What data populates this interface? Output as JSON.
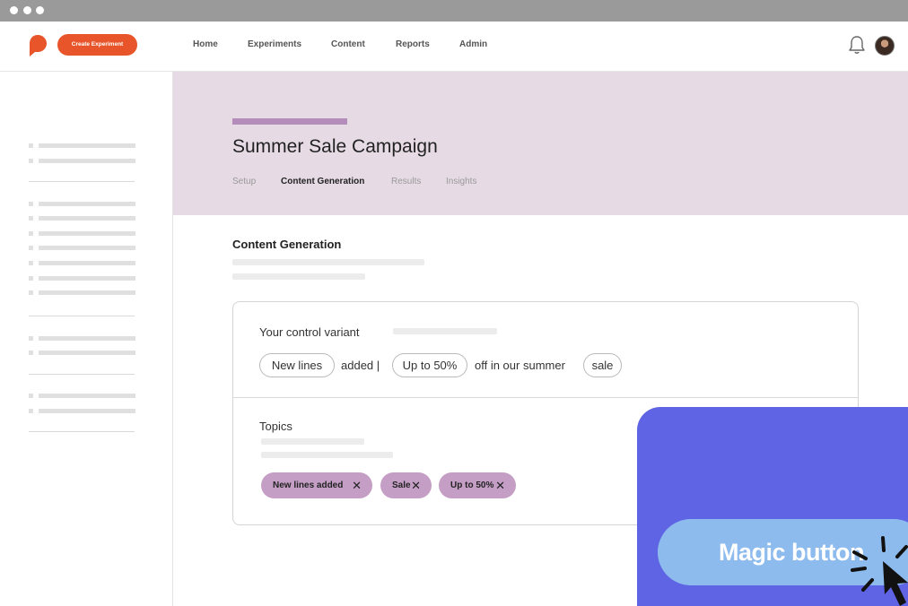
{
  "header": {
    "create_button": "Create Experiment",
    "nav": [
      "Home",
      "Experiments",
      "Content",
      "Reports",
      "Admin"
    ]
  },
  "page": {
    "title": "Summer Sale Campaign",
    "tabs": [
      "Setup",
      "Content Generation",
      "Results",
      "Insights"
    ],
    "active_tab": "Content Generation"
  },
  "content": {
    "section_title": "Content Generation",
    "control_label": "Your control variant",
    "variant": {
      "chip1": "New lines",
      "text1": "added |",
      "chip2": "Up to 50%",
      "text2": "off in our summer",
      "chip3": "sale"
    },
    "topics_label": "Topics",
    "tags": [
      "New lines added",
      "Sale",
      "Up to 50%"
    ],
    "tag_remove_glyph": "✕"
  },
  "overlay": {
    "magic_button": "Magic button"
  },
  "colors": {
    "brand_orange": "#e8552a",
    "header_band": "#e6dbe5",
    "accent_purple": "#b48dba",
    "tag_purple": "#c49ec5",
    "panel_blue": "#5e64e3",
    "magic_button": "#8dbbee"
  },
  "icons": {
    "logo": "speech-bubble-logo-icon",
    "notifications": "bell-icon",
    "cursor": "pointer-cursor-icon"
  }
}
